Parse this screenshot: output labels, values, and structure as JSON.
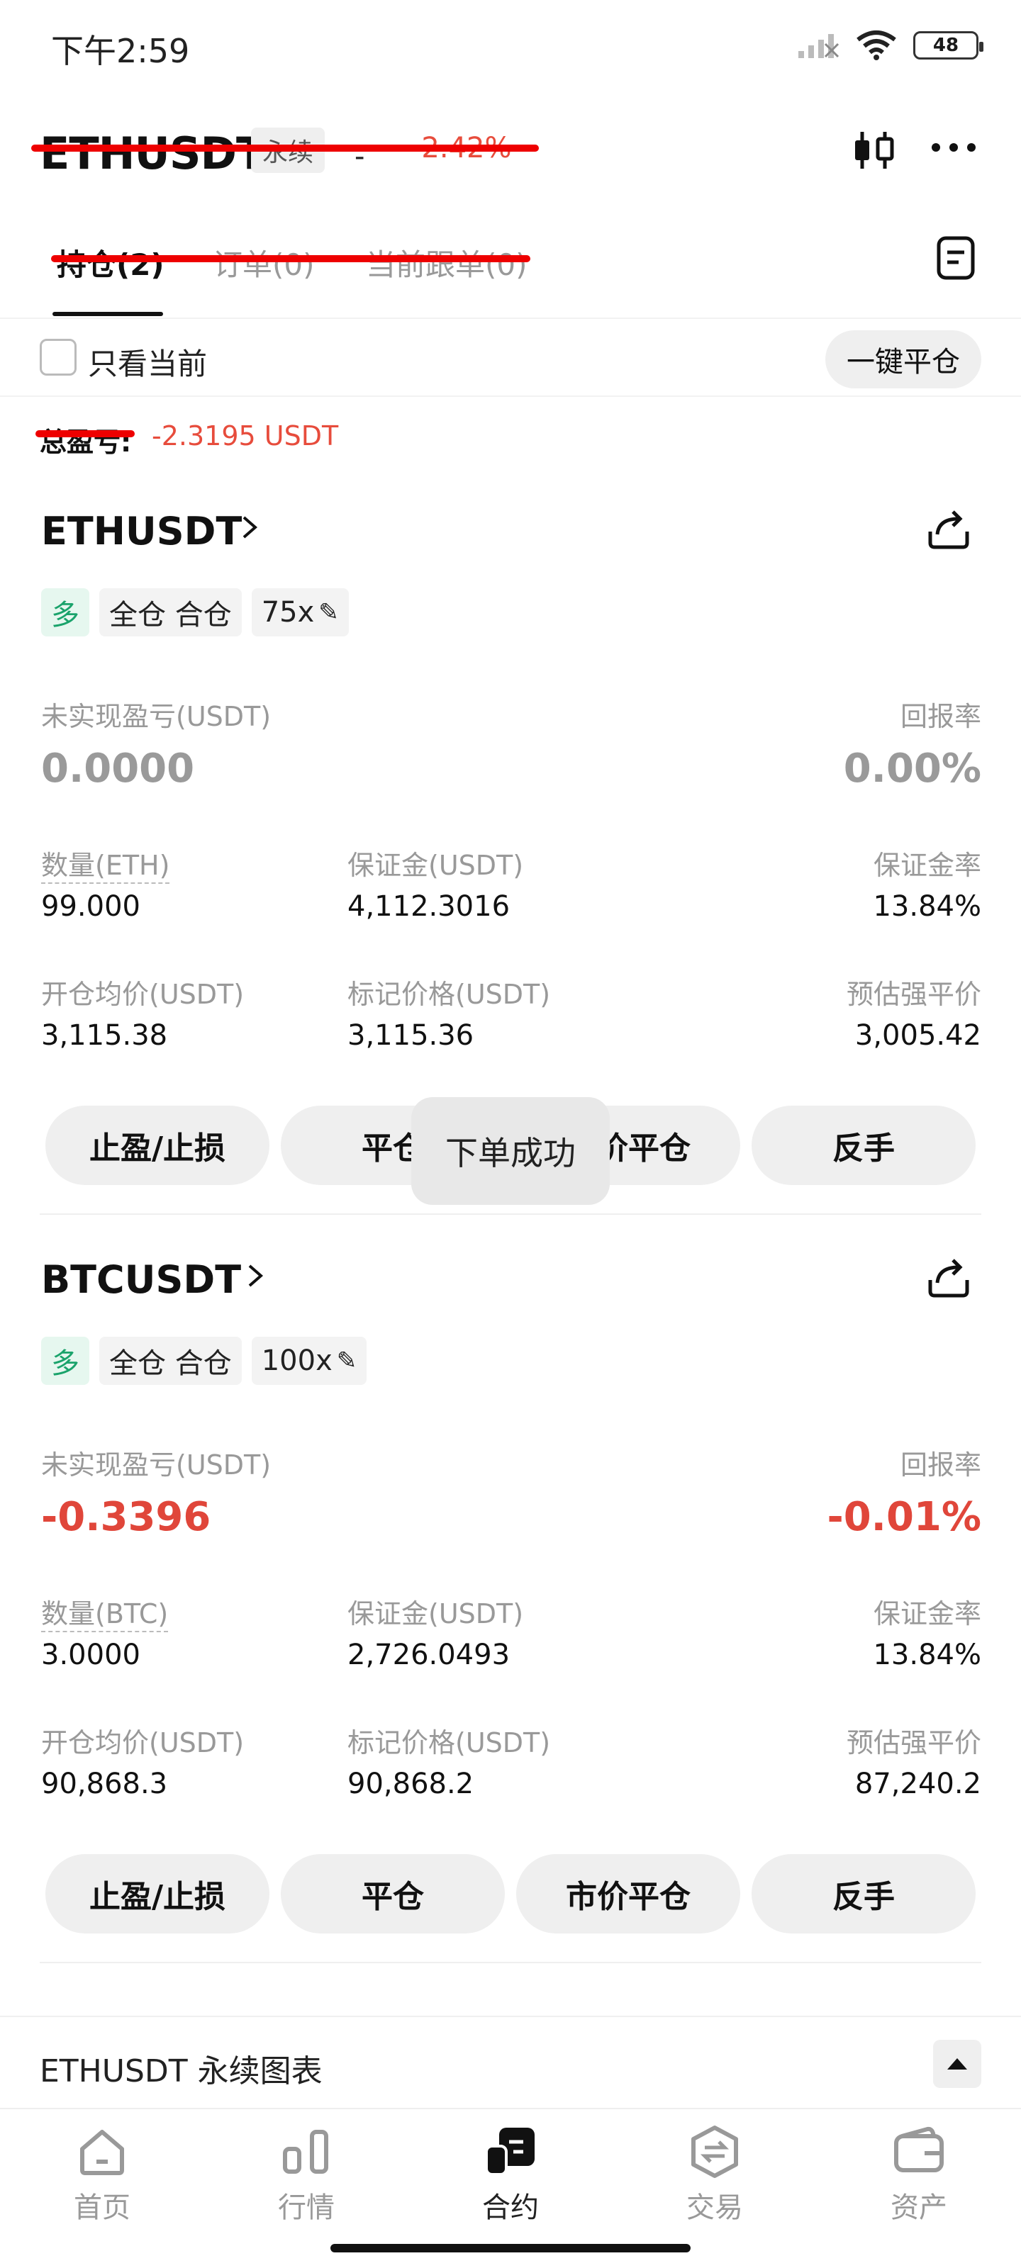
{
  "status_bar": {
    "time": "下午2:59",
    "battery": "48"
  },
  "header": {
    "symbol": "ETHUSDT",
    "perp_tag": "永续",
    "dash": "-",
    "change": "-2.42%"
  },
  "tabs": [
    {
      "label": "持仓(2)"
    },
    {
      "label": "订单(0)"
    },
    {
      "label": "当前跟单(0)"
    }
  ],
  "filter": {
    "only_current": "只看当前",
    "close_all": "一键平仓"
  },
  "total": {
    "label": "总盈亏",
    "colon": ":",
    "value": "-2.3195 USDT"
  },
  "positions": [
    {
      "symbol": "ETHUSDT",
      "tags": [
        "多",
        "全仓 合仓",
        "75x"
      ],
      "pnl_label": "未实现盈亏(USDT)",
      "pnl_value": "0.0000",
      "roe_label": "回报率",
      "roe_value": "0.00%",
      "qty_label": "数量(ETH)",
      "qty_value": "99.000",
      "margin_label": "保证金(USDT)",
      "margin_value": "4,112.3016",
      "margin_rate_label": "保证金率",
      "margin_rate_value": "13.84%",
      "entry_label": "开仓均价(USDT)",
      "entry_value": "3,115.38",
      "mark_label": "标记价格(USDT)",
      "mark_value": "3,115.36",
      "liq_label": "预估强平价",
      "liq_value": "3,005.42",
      "buttons": [
        "止盈/止损",
        "平仓",
        "市价平仓",
        "反手"
      ]
    },
    {
      "symbol": "BTCUSDT",
      "tags": [
        "多",
        "全仓 合仓",
        "100x"
      ],
      "pnl_label": "未实现盈亏(USDT)",
      "pnl_value": "-0.3396",
      "roe_label": "回报率",
      "roe_value": "-0.01%",
      "qty_label": "数量(BTC)",
      "qty_value": "3.0000",
      "margin_label": "保证金(USDT)",
      "margin_value": "2,726.0493",
      "margin_rate_label": "保证金率",
      "margin_rate_value": "13.84%",
      "entry_label": "开仓均价(USDT)",
      "entry_value": "90,868.3",
      "mark_label": "标记价格(USDT)",
      "mark_value": "90,868.2",
      "liq_label": "预估强平价",
      "liq_value": "87,240.2",
      "buttons": [
        "止盈/止损",
        "平仓",
        "市价平仓",
        "反手"
      ]
    }
  ],
  "toast": "下单成功",
  "chart_row": {
    "title": "ETHUSDT 永续图表"
  },
  "nav": [
    {
      "label": "首页",
      "icon": "home-icon"
    },
    {
      "label": "行情",
      "icon": "market-icon"
    },
    {
      "label": "合约",
      "icon": "futures-icon"
    },
    {
      "label": "交易",
      "icon": "trade-icon"
    },
    {
      "label": "资产",
      "icon": "wallet-icon"
    }
  ],
  "colors": {
    "red": "#e0463a",
    "green": "#1aa36b",
    "strike": "#ee0000"
  }
}
